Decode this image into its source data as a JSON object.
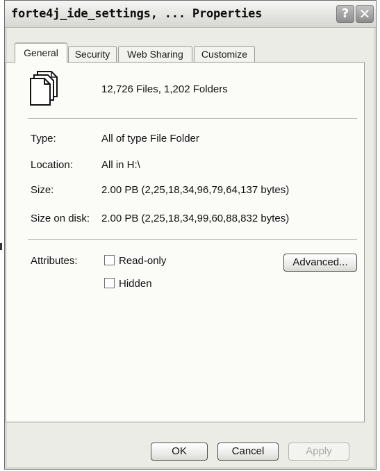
{
  "window": {
    "title": "forte4j_ide_settings, ... Properties",
    "help_label": "?",
    "close_label": "✕"
  },
  "tabs": [
    {
      "label": "General"
    },
    {
      "label": "Security"
    },
    {
      "label": "Web Sharing"
    },
    {
      "label": "Customize"
    }
  ],
  "general": {
    "contents": "12,726 Files, 1,202 Folders",
    "properties": [
      {
        "label": "Type:",
        "value": "All of type File Folder"
      },
      {
        "label": "Location:",
        "value": "All in H:\\"
      },
      {
        "label": "Size:",
        "value": "2.00 PB (2,25,18,34,96,79,64,137 bytes)"
      },
      {
        "label": "Size on disk:",
        "value": "2.00 PB (2,25,18,34,99,60,88,832 bytes)"
      }
    ],
    "attributes": {
      "label": "Attributes:",
      "read_only": "Read-only",
      "hidden": "Hidden",
      "advanced_label": "Advanced..."
    }
  },
  "buttons": {
    "ok": "OK",
    "cancel": "Cancel",
    "apply": "Apply"
  },
  "icons": {
    "folder": "multiple-documents-icon",
    "help": "help-icon",
    "close": "close-icon"
  }
}
